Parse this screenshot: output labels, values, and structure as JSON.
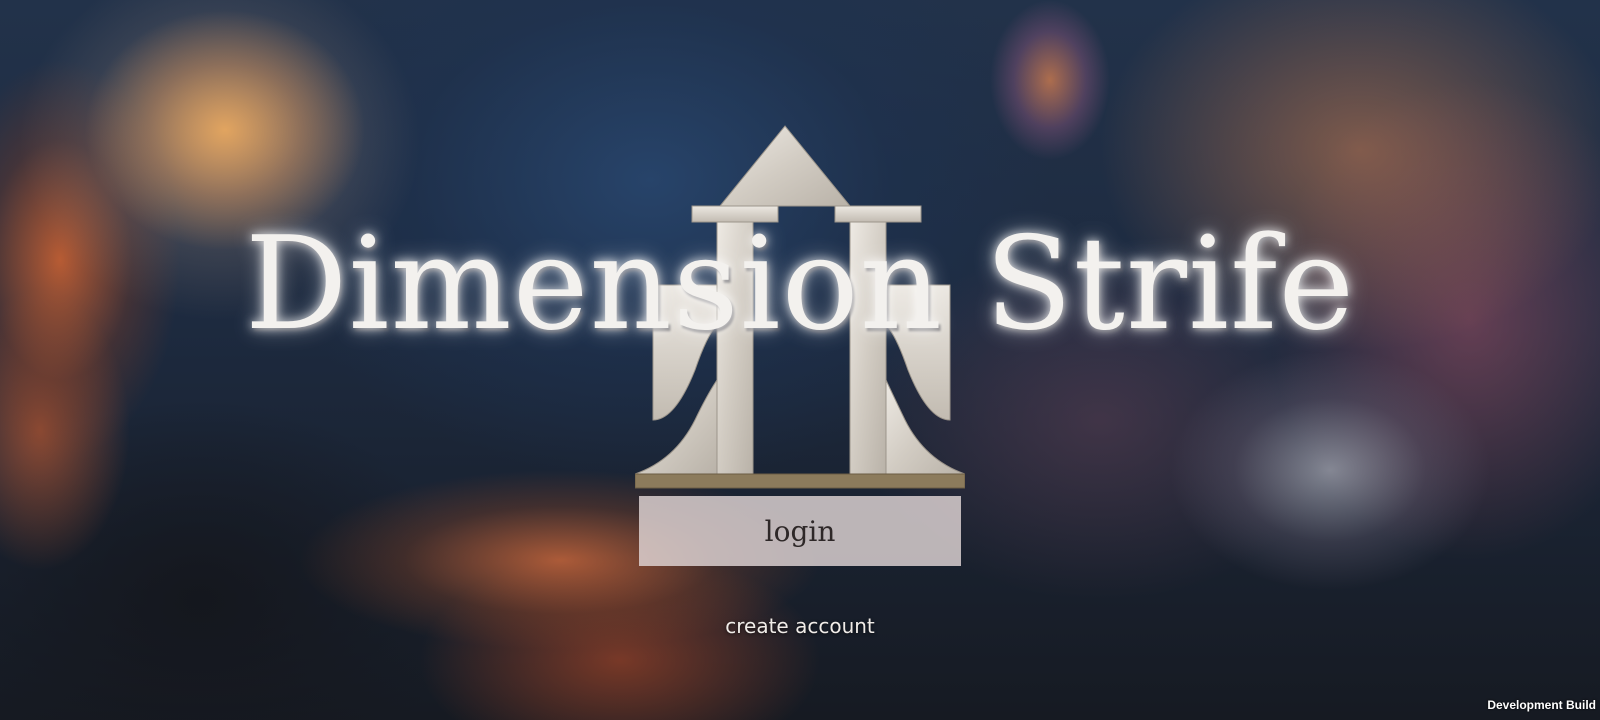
{
  "app": {
    "title": "Dimension Strife"
  },
  "menu": {
    "login_label": "login",
    "create_account_label": "create account"
  },
  "footer": {
    "build_label": "Development Build"
  },
  "icons": {
    "emblem": "gate-emblem-icon"
  },
  "colors": {
    "title_text": "#f3f1ee",
    "login_bg": "#e0d6d6",
    "login_text": "#2e2828",
    "link_text": "#f0ece8"
  }
}
